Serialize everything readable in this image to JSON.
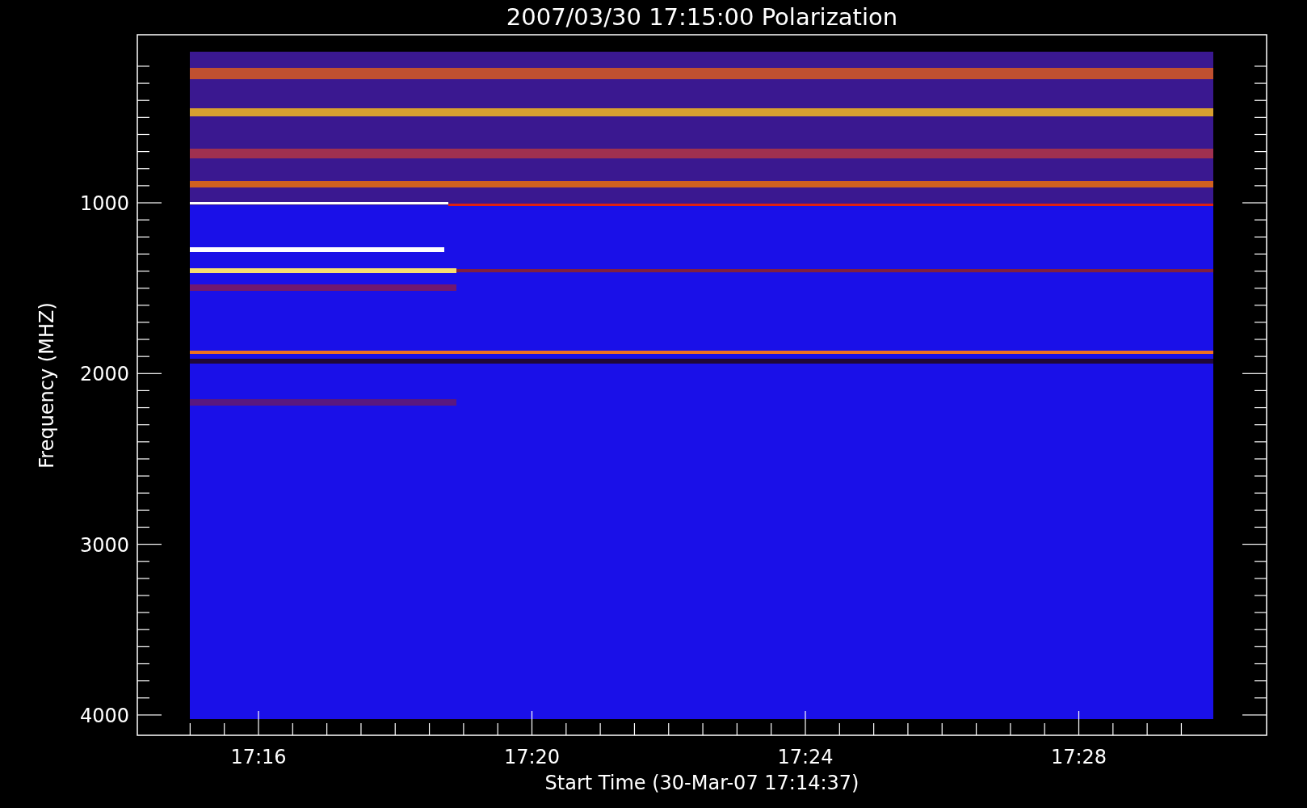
{
  "plot": {
    "title": "2007/03/30 17:15:00 Polarization",
    "ylabel": "Frequency (MHZ)",
    "xlabel": "Start Time (30-Mar-07 17:14:37)",
    "yticks": [
      "1000",
      "2000",
      "3000",
      "4000"
    ],
    "xticks": [
      "17:16",
      "17:20",
      "17:24",
      "17:28"
    ]
  }
}
